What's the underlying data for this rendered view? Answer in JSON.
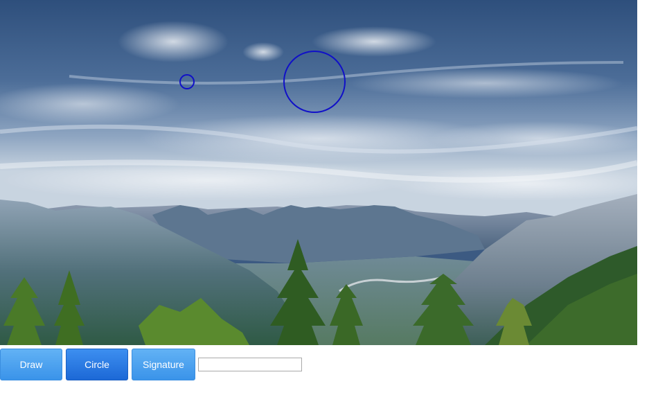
{
  "toolbar": {
    "draw_label": "Draw",
    "circle_label": "Circle",
    "signature_label": "Signature",
    "text_value": "",
    "active_tool": "Circle"
  },
  "canvas": {
    "image_subject": "mountain valley landscape with evergreen trees under a cloudy blue sky",
    "annotation_color": "#1010c8",
    "annotations": [
      {
        "type": "circle",
        "name": "small-circle"
      },
      {
        "type": "circle",
        "name": "large-circle"
      }
    ]
  },
  "colors": {
    "button": "#4aa0ee",
    "button_active": "#2a78e0",
    "button_text": "#ffffff"
  }
}
